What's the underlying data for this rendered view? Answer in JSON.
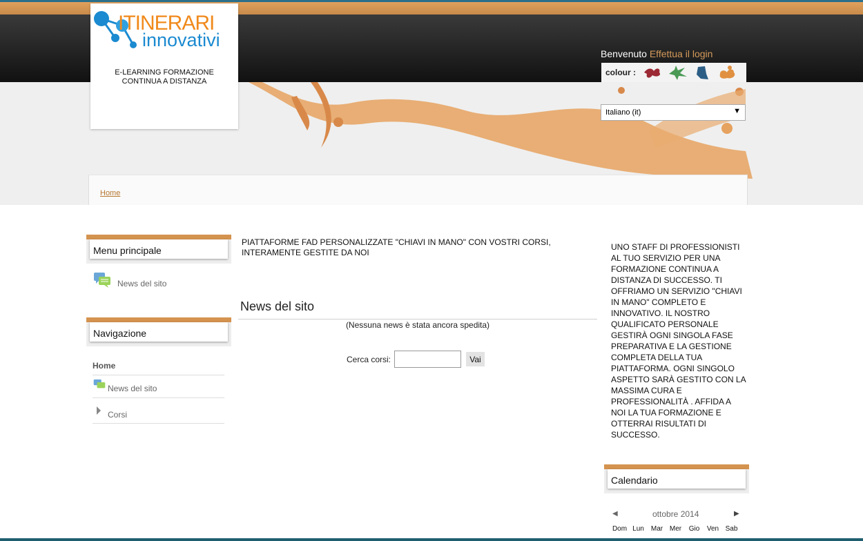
{
  "header": {
    "logo_line1": "ITINERARI",
    "logo_line2": "innovativi",
    "tagline": "E-LEARNING FORMAZIONE CONTINUA A DISTANZA",
    "welcome": "Benvenuto",
    "login_link": "Effettua il login",
    "colour_label": "colour :",
    "colour_swatches": [
      "#9c2a35",
      "#4a9a55",
      "#2d5f86",
      "#e09040"
    ],
    "language_selected": "Italiano (it)"
  },
  "breadcrumb": {
    "home": "Home"
  },
  "left": {
    "menu_title": "Menu principale",
    "menu_items": [
      "News del sito"
    ],
    "nav_title": "Navigazione",
    "nav_home": "Home",
    "nav_items": [
      "News del sito",
      "Corsi"
    ]
  },
  "main": {
    "intro": "PIATTAFORME FAD PERSONALIZZATE \"CHIAVI IN MANO\" CON VOSTRI CORSI, INTERAMENTE GESTITE DA NOI",
    "news_title": "News del sito",
    "news_empty": "(Nessuna news è stata ancora spedita)",
    "search_label": "Cerca corsi:",
    "search_value": "",
    "search_button": "Vai"
  },
  "right": {
    "description": "UNO STAFF DI PROFESSIONISTI AL TUO SERVIZIO PER UNA FORMAZIONE CONTINUA A DISTANZA DI SUCCESSO. TI OFFRIAMO UN SERVIZIO \"CHIAVI IN MANO\" COMPLETO E INNOVATIVO. IL NOSTRO QUALIFICATO PERSONALE GESTIRÀ OGNI SINGOLA FASE PREPARATIVA E LA GESTIONE COMPLETA DELLA TUA PIATTAFORMA. OGNI SINGOLO ASPETTO SARÀ GESTITO CON LA MASSIMA CURA E PROFESSIONALITÀ . AFFIDA A NOI LA TUA FORMAZIONE E OTTERRAI RISULTATI DI SUCCESSO.",
    "calendar_title": "Calendario",
    "calendar_month": "ottobre 2014",
    "calendar_days": [
      "Dom",
      "Lun",
      "Mar",
      "Mer",
      "Gio",
      "Ven",
      "Sab"
    ]
  },
  "icons": {
    "news": "news-chat-icon",
    "arrow": "triangle-right-icon"
  }
}
